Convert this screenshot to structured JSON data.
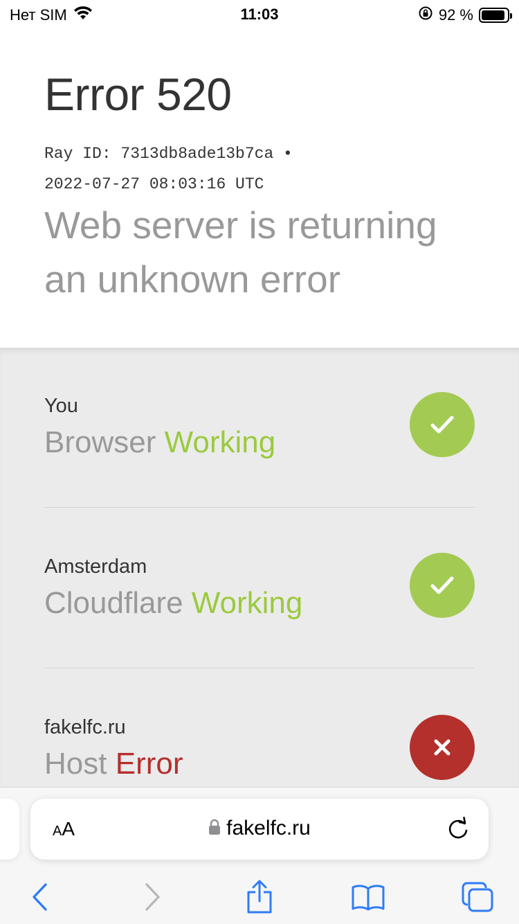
{
  "status_bar": {
    "carrier": "Нет SIM",
    "time": "11:03",
    "battery_text": "92 %",
    "battery_level": 0.92
  },
  "error": {
    "title": "Error 520",
    "ray_line1": "Ray ID: 7313db8ade13b7ca •",
    "ray_line2": "2022-07-27 08:03:16 UTC",
    "subtitle": "Web server is returning an unknown error"
  },
  "status_rows": [
    {
      "location": "You",
      "component": "Browser",
      "state": "Working",
      "state_type": "ok"
    },
    {
      "location": "Amsterdam",
      "component": "Cloudflare",
      "state": "Working",
      "state_type": "ok"
    },
    {
      "location": "fakelfc.ru",
      "component": "Host",
      "state": "Error",
      "state_type": "error"
    }
  ],
  "browser": {
    "aa_label_small": "A",
    "aa_label_large": "A",
    "url": "fakelfc.ru"
  },
  "colors": {
    "ok": "#9bca3e",
    "error": "#b52f2f",
    "ios_blue": "#2f7cf6"
  },
  "icons": {
    "wifi": "wifi-icon",
    "rotation_lock": "rotation-lock-icon",
    "check": "check-icon",
    "close": "close-icon",
    "lock": "lock-icon",
    "reload": "reload-icon",
    "back": "back-icon",
    "forward": "forward-icon",
    "share": "share-icon",
    "bookmarks": "bookmarks-icon",
    "tabs": "tabs-icon"
  }
}
